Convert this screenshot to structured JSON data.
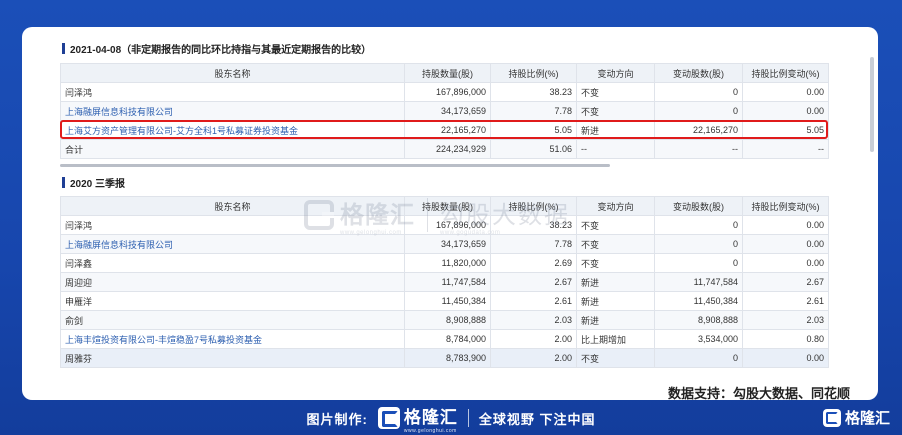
{
  "section1": {
    "title": "2021-04-08（非定期报告的同比环比持指与其最近定期报告的比较）",
    "headers": [
      "股东名称",
      "持股数量(股)",
      "持股比例(%)",
      "变动方向",
      "变动股数(股)",
      "持股比例变动(%)"
    ],
    "rows": [
      {
        "name": "闫泽鸿",
        "shares": "167,896,000",
        "ratio": "38.23",
        "dir": "不变",
        "chg": "0",
        "ratio_chg": "0.00"
      },
      {
        "name": "上海融屏信息科技有限公司",
        "shares": "34,173,659",
        "ratio": "7.78",
        "dir": "不变",
        "chg": "0",
        "ratio_chg": "0.00"
      },
      {
        "name": "上海艾方资产管理有限公司-艾方全科1号私募证券投资基金",
        "shares": "22,165,270",
        "ratio": "5.05",
        "dir": "新进",
        "chg": "22,165,270",
        "ratio_chg": "5.05"
      },
      {
        "name": "合计",
        "shares": "224,234,929",
        "ratio": "51.06",
        "dir": "--",
        "chg": "--",
        "ratio_chg": "--"
      }
    ]
  },
  "section2": {
    "title": "2020 三季报",
    "headers": [
      "股东名称",
      "持股数量(股)",
      "持股比例(%)",
      "变动方向",
      "变动股数(股)",
      "持股比例变动(%)"
    ],
    "rows": [
      {
        "name": "闫泽鸿",
        "shares": "167,896,000",
        "ratio": "38.23",
        "dir": "不变",
        "chg": "0",
        "ratio_chg": "0.00"
      },
      {
        "name": "上海融屏信息科技有限公司",
        "shares": "34,173,659",
        "ratio": "7.78",
        "dir": "不变",
        "chg": "0",
        "ratio_chg": "0.00"
      },
      {
        "name": "闫泽鑫",
        "shares": "11,820,000",
        "ratio": "2.69",
        "dir": "不变",
        "chg": "0",
        "ratio_chg": "0.00"
      },
      {
        "name": "周迎迎",
        "shares": "11,747,584",
        "ratio": "2.67",
        "dir": "新进",
        "chg": "11,747,584",
        "ratio_chg": "2.67"
      },
      {
        "name": "申雁洋",
        "shares": "11,450,384",
        "ratio": "2.61",
        "dir": "新进",
        "chg": "11,450,384",
        "ratio_chg": "2.61"
      },
      {
        "name": "俞剑",
        "shares": "8,908,888",
        "ratio": "2.03",
        "dir": "新进",
        "chg": "8,908,888",
        "ratio_chg": "2.03"
      },
      {
        "name": "上海丰煊投资有限公司-丰煊稳盈7号私募投资基金",
        "shares": "8,784,000",
        "ratio": "2.00",
        "dir": "比上期增加",
        "chg": "3,534,000",
        "ratio_chg": "0.80"
      },
      {
        "name": "周雅芬",
        "shares": "8,783,900",
        "ratio": "2.00",
        "dir": "不变",
        "chg": "0",
        "ratio_chg": "0.00"
      }
    ]
  },
  "watermark": {
    "brand": "格隆汇",
    "brand_sub": "www.gelonghui.com",
    "brand2": "勾股大数据",
    "brand2_sub": "www.gogudata.com"
  },
  "support_text": "数据支持：勾股大数据、同花顺",
  "footer": {
    "made_label": "图片制作:",
    "brand": "格隆汇",
    "brand_sub": "www.gelonghui.com",
    "slogan": "全球视野 下注中国"
  },
  "corner_brand": "格隆汇",
  "colors": {
    "background": "#1b4fb8",
    "highlight": "#e01b1b",
    "link": "#2d5fb0"
  }
}
